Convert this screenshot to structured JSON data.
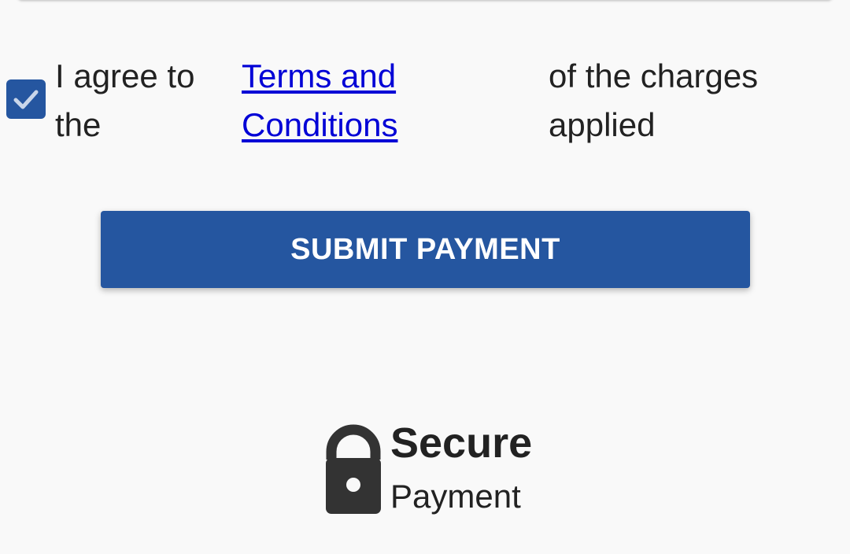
{
  "agreement": {
    "checked": true,
    "text_before": "I agree to the",
    "link_text": "Terms and Conditions",
    "text_after": "of the charges applied"
  },
  "submit": {
    "label": "SUBMIT PAYMENT"
  },
  "secure": {
    "icon": "lock-icon",
    "title": "Secure",
    "subtitle": "Payment"
  },
  "colors": {
    "accent": "#2556a0",
    "link": "#0000d6",
    "background": "#f9f9f9",
    "text": "#222222"
  }
}
